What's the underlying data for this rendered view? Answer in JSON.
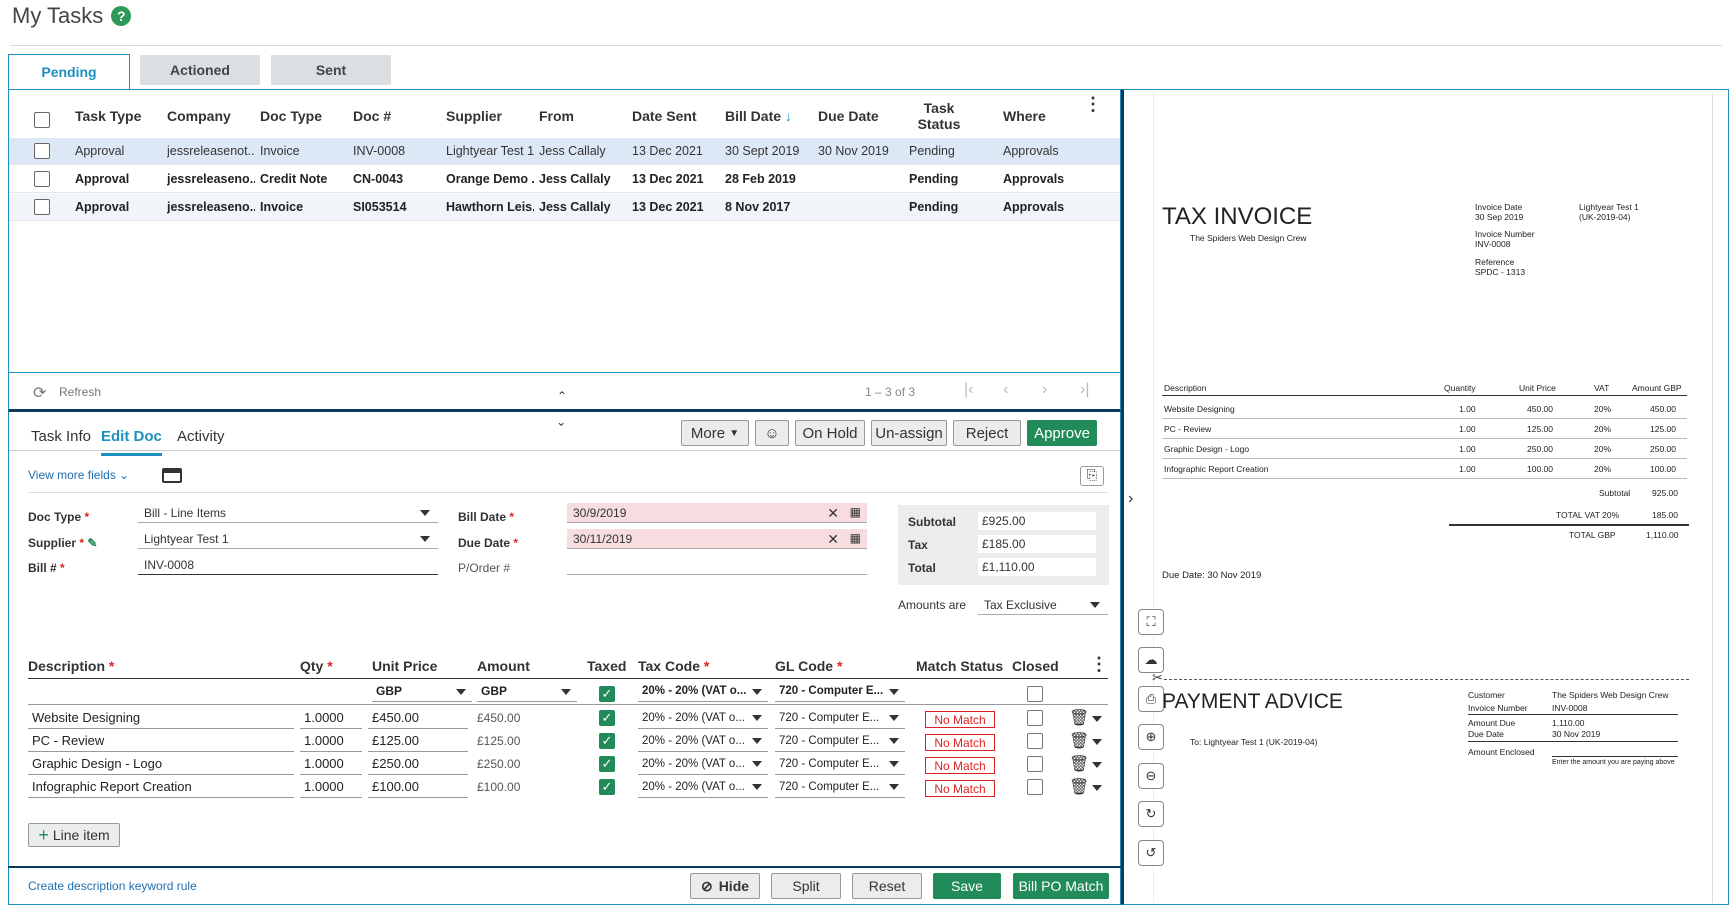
{
  "title": "My Tasks",
  "tabs": [
    "Pending",
    "Actioned",
    "Sent"
  ],
  "columns": [
    "Task Type",
    "Company",
    "Doc Type",
    "Doc #",
    "Supplier",
    "From",
    "Date Sent",
    "Bill Date",
    "Due Date",
    "Task Status",
    "Where"
  ],
  "rows": [
    [
      "Approval",
      "jessreleasenot...",
      "Invoice",
      "INV-0008",
      "Lightyear Test 1",
      "Jess Callaly",
      "13 Dec 2021",
      "30 Sept 2019",
      "30 Nov 2019",
      "Pending",
      "Approvals"
    ],
    [
      "Approval",
      "jessreleaseno...",
      "Credit Note",
      "CN-0043",
      "Orange Demo ...",
      "Jess Callaly",
      "13 Dec 2021",
      "28 Feb 2019",
      "",
      "Pending",
      "Approvals"
    ],
    [
      "Approval",
      "jessreleaseno...",
      "Invoice",
      "SI053514",
      "Hawthorn Leis...",
      "Jess Callaly",
      "13 Dec 2021",
      "8 Nov 2017",
      "",
      "Pending",
      "Approvals"
    ]
  ],
  "pager": {
    "refresh": "Refresh",
    "range": "1 – 3 of 3"
  },
  "subtabs": [
    "Task Info",
    "Edit Doc",
    "Activity"
  ],
  "actions": {
    "more": "More",
    "onhold": "On Hold",
    "unassign": "Un-assign",
    "reject": "Reject",
    "approve": "Approve"
  },
  "view_more": "View more fields",
  "form": {
    "doc_type_label": "Doc Type",
    "doc_type": "Bill - Line Items",
    "supplier_label": "Supplier",
    "supplier": "Lightyear Test 1",
    "bill_no_label": "Bill #",
    "bill_no": "INV-0008",
    "bill_date_label": "Bill Date",
    "bill_date": "30/9/2019",
    "due_date_label": "Due Date",
    "due_date": "30/11/2019",
    "porder_label": "P/Order #",
    "subtotal_label": "Subtotal",
    "subtotal": "£925.00",
    "tax_label": "Tax",
    "tax": "£185.00",
    "total_label": "Total",
    "total": "£1,110.00",
    "amounts_are_label": "Amounts are",
    "amounts_are": "Tax Exclusive"
  },
  "line_headers": [
    "Description",
    "Qty",
    "Unit Price",
    "Amount",
    "Taxed",
    "Tax Code",
    "GL Code",
    "Match Status",
    "Closed"
  ],
  "line_defaults": {
    "unit_cur": "GBP",
    "amount_cur": "GBP",
    "tax_code": "20% - 20% (VAT o...",
    "gl_code": "720 - Computer E..."
  },
  "lines": [
    {
      "desc": "Website Designing",
      "qty": "1.0000",
      "unit": "£450.00",
      "amount": "£450.00",
      "tax": "20% - 20% (VAT o...",
      "gl": "720 - Computer E...",
      "match": "No Match"
    },
    {
      "desc": "PC - Review",
      "qty": "1.0000",
      "unit": "£125.00",
      "amount": "£125.00",
      "tax": "20% - 20% (VAT o...",
      "gl": "720 - Computer E...",
      "match": "No Match"
    },
    {
      "desc": "Graphic Design - Logo",
      "qty": "1.0000",
      "unit": "£250.00",
      "amount": "£250.00",
      "tax": "20% - 20% (VAT o...",
      "gl": "720 - Computer E...",
      "match": "No Match"
    },
    {
      "desc": "Infographic Report Creation",
      "qty": "1.0000",
      "unit": "£100.00",
      "amount": "£100.00",
      "tax": "20% - 20% (VAT o...",
      "gl": "720 - Computer E...",
      "match": "No Match"
    }
  ],
  "line_item_btn": "Line item",
  "keyword_link": "Create description keyword rule",
  "footer": {
    "hide": "Hide",
    "split": "Split",
    "reset": "Reset",
    "save": "Save",
    "bill_po": "Bill PO Match"
  },
  "invoice": {
    "title": "TAX INVOICE",
    "from": "The Spiders Web Design Crew",
    "inv_date_label": "Invoice Date",
    "inv_date": "30 Sep 2019",
    "inv_no_label": "Invoice Number",
    "inv_no": "INV-0008",
    "ref_label": "Reference",
    "ref": "SPDC - 1313",
    "to_name": "Lightyear Test 1",
    "to_code": "(UK-2019-04)",
    "cols": [
      "Description",
      "Quantity",
      "Unit Price",
      "VAT",
      "Amount GBP"
    ],
    "items": [
      [
        "Website Designing",
        "1.00",
        "450.00",
        "20%",
        "450.00"
      ],
      [
        "PC - Review",
        "1.00",
        "125.00",
        "20%",
        "125.00"
      ],
      [
        "Graphic Design - Logo",
        "1.00",
        "250.00",
        "20%",
        "250.00"
      ],
      [
        "Infographic Report Creation",
        "1.00",
        "100.00",
        "20%",
        "100.00"
      ]
    ],
    "subtotal_label": "Subtotal",
    "subtotal": "925.00",
    "vat_label": "TOTAL VAT 20%",
    "vat": "185.00",
    "total_label": "TOTAL GBP",
    "total": "1,110.00",
    "due": "Due Date: 30 Nov 2019",
    "pa_title": "PAYMENT ADVICE",
    "pa_to": "To:  Lightyear Test 1 (UK-2019-04)",
    "pa_customer_label": "Customer",
    "pa_customer": "The Spiders Web Design Crew",
    "pa_inv_label": "Invoice Number",
    "pa_inv": "INV-0008",
    "pa_due_amt_label": "Amount Due",
    "pa_due_amt": "1,110.00",
    "pa_due_date_label": "Due Date",
    "pa_due_date": "30 Nov 2019",
    "pa_enclosed_label": "Amount Enclosed",
    "pa_note": "Enter the amount you are paying above"
  }
}
